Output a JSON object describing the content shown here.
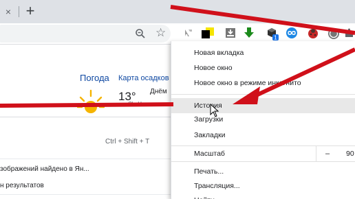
{
  "tabstrip": {
    "close_glyph": "×",
    "new_tab_glyph": "+"
  },
  "toolbar": {
    "star_glyph": "☆",
    "extension_icons": [
      "translate-icon",
      "color-picker-icon",
      "download-ext-icon",
      "green-arrow-icon",
      "cube-ext-icon",
      "infinity-ext-icon",
      "ladybug-ext-icon",
      "whatsapp-ext-icon",
      "puzzle-icon"
    ],
    "badge_value": "1"
  },
  "page": {
    "weather_title": "Погода",
    "rain_map": "Карта осадков",
    "temperature": "13°",
    "day_label": "Днём",
    "tiny_label": "Cl...H...",
    "shortcut_hint": "Ctrl + Shift + T",
    "result_1": "зображений найдено в Ян...",
    "result_2": "н результатов"
  },
  "menu": {
    "items": [
      {
        "label": "Новая вкладка"
      },
      {
        "label": "Новое окно"
      },
      {
        "label": "Новое окно в режиме инкогнито"
      },
      {
        "label": "История"
      },
      {
        "label": "Загрузки"
      },
      {
        "label": "Закладки"
      },
      {
        "label": "Масштаб"
      },
      {
        "label": "Печать..."
      },
      {
        "label": "Трансляция..."
      },
      {
        "label": "Найти..."
      }
    ],
    "zoom_minus": "–",
    "zoom_value": "90"
  },
  "colors": {
    "annotation_red": "#d0101a",
    "link_blue": "#0d47a1",
    "hover_grey": "#e8e8e8"
  }
}
